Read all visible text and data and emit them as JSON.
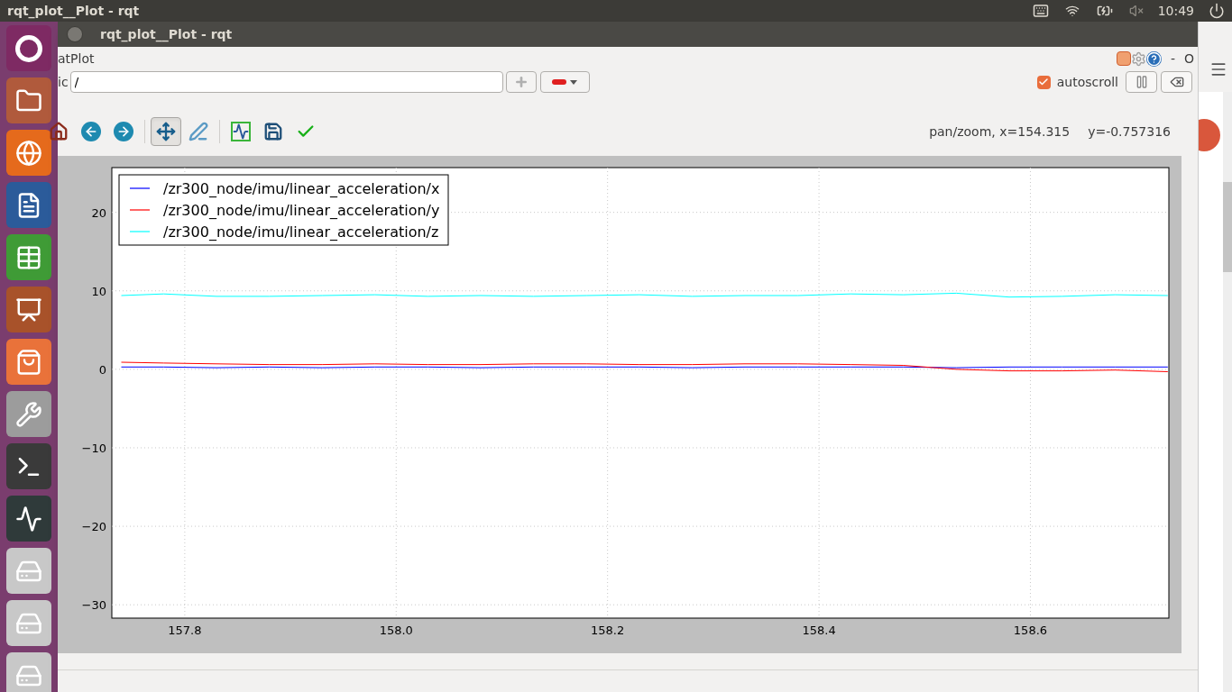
{
  "top_bar": {
    "title": "rqt_plot__Plot - rqt",
    "clock": "10:49"
  },
  "window": {
    "title": "rqt_plot__Plot - rqt"
  },
  "plugin": {
    "title": "atPlot",
    "controls": [
      "-",
      "O"
    ]
  },
  "topic": {
    "label": "ic",
    "value": "/"
  },
  "autoscroll": {
    "label": "autoscroll",
    "checked": true
  },
  "toolbar": [
    {
      "kind": "home",
      "selected": false
    },
    {
      "kind": "back",
      "selected": false
    },
    {
      "kind": "forward",
      "selected": false
    },
    {
      "kind": "pan",
      "selected": true
    },
    {
      "kind": "zoom",
      "selected": false
    },
    {
      "kind": "subplots",
      "selected": false
    },
    {
      "kind": "save",
      "selected": false
    },
    {
      "kind": "edit",
      "selected": false
    }
  ],
  "status": {
    "coords_x": "pan/zoom, x=154.315",
    "coords_y": "y=-0.757316"
  },
  "chart_data": {
    "type": "line",
    "xlim": [
      157.731,
      158.731
    ],
    "ylim": [
      -31.7,
      25.7
    ],
    "grid": true,
    "legend": true,
    "xticks": [
      {
        "value": 157.8,
        "label": "157.8"
      },
      {
        "value": 158,
        "label": "158.0"
      },
      {
        "value": 158.2,
        "label": "158.2"
      },
      {
        "value": 158.4,
        "label": "158.4"
      },
      {
        "value": 158.6,
        "label": "158.6"
      }
    ],
    "yticks": [
      -30,
      -20,
      -10,
      0,
      10,
      20
    ],
    "x": [
      157.74,
      157.78,
      157.83,
      157.88,
      157.93,
      157.98,
      158.03,
      158.08,
      158.13,
      158.18,
      158.23,
      158.28,
      158.33,
      158.38,
      158.43,
      158.48,
      158.53,
      158.58,
      158.63,
      158.68,
      158.73
    ],
    "series": [
      {
        "name": "/zr300_node/imu/linear_acceleration/x",
        "color": "#0000ff",
        "values": [
          0.3,
          0.3,
          0.2,
          0.3,
          0.2,
          0.3,
          0.3,
          0.2,
          0.3,
          0.3,
          0.3,
          0.2,
          0.3,
          0.3,
          0.3,
          0.3,
          0.2,
          0.3,
          0.3,
          0.3,
          0.3
        ]
      },
      {
        "name": "/zr300_node/imu/linear_acceleration/y",
        "color": "#ff0000",
        "values": [
          0.9,
          0.8,
          0.7,
          0.6,
          0.6,
          0.7,
          0.6,
          0.6,
          0.7,
          0.7,
          0.6,
          0.6,
          0.7,
          0.7,
          0.6,
          0.5,
          0.0,
          -0.2,
          -0.2,
          -0.1,
          -0.3
        ]
      },
      {
        "name": "/zr300_node/imu/linear_acceleration/z",
        "color": "#00ffff",
        "values": [
          9.4,
          9.6,
          9.3,
          9.3,
          9.4,
          9.5,
          9.3,
          9.4,
          9.3,
          9.4,
          9.5,
          9.3,
          9.4,
          9.4,
          9.6,
          9.5,
          9.7,
          9.2,
          9.3,
          9.5,
          9.4
        ]
      }
    ]
  }
}
